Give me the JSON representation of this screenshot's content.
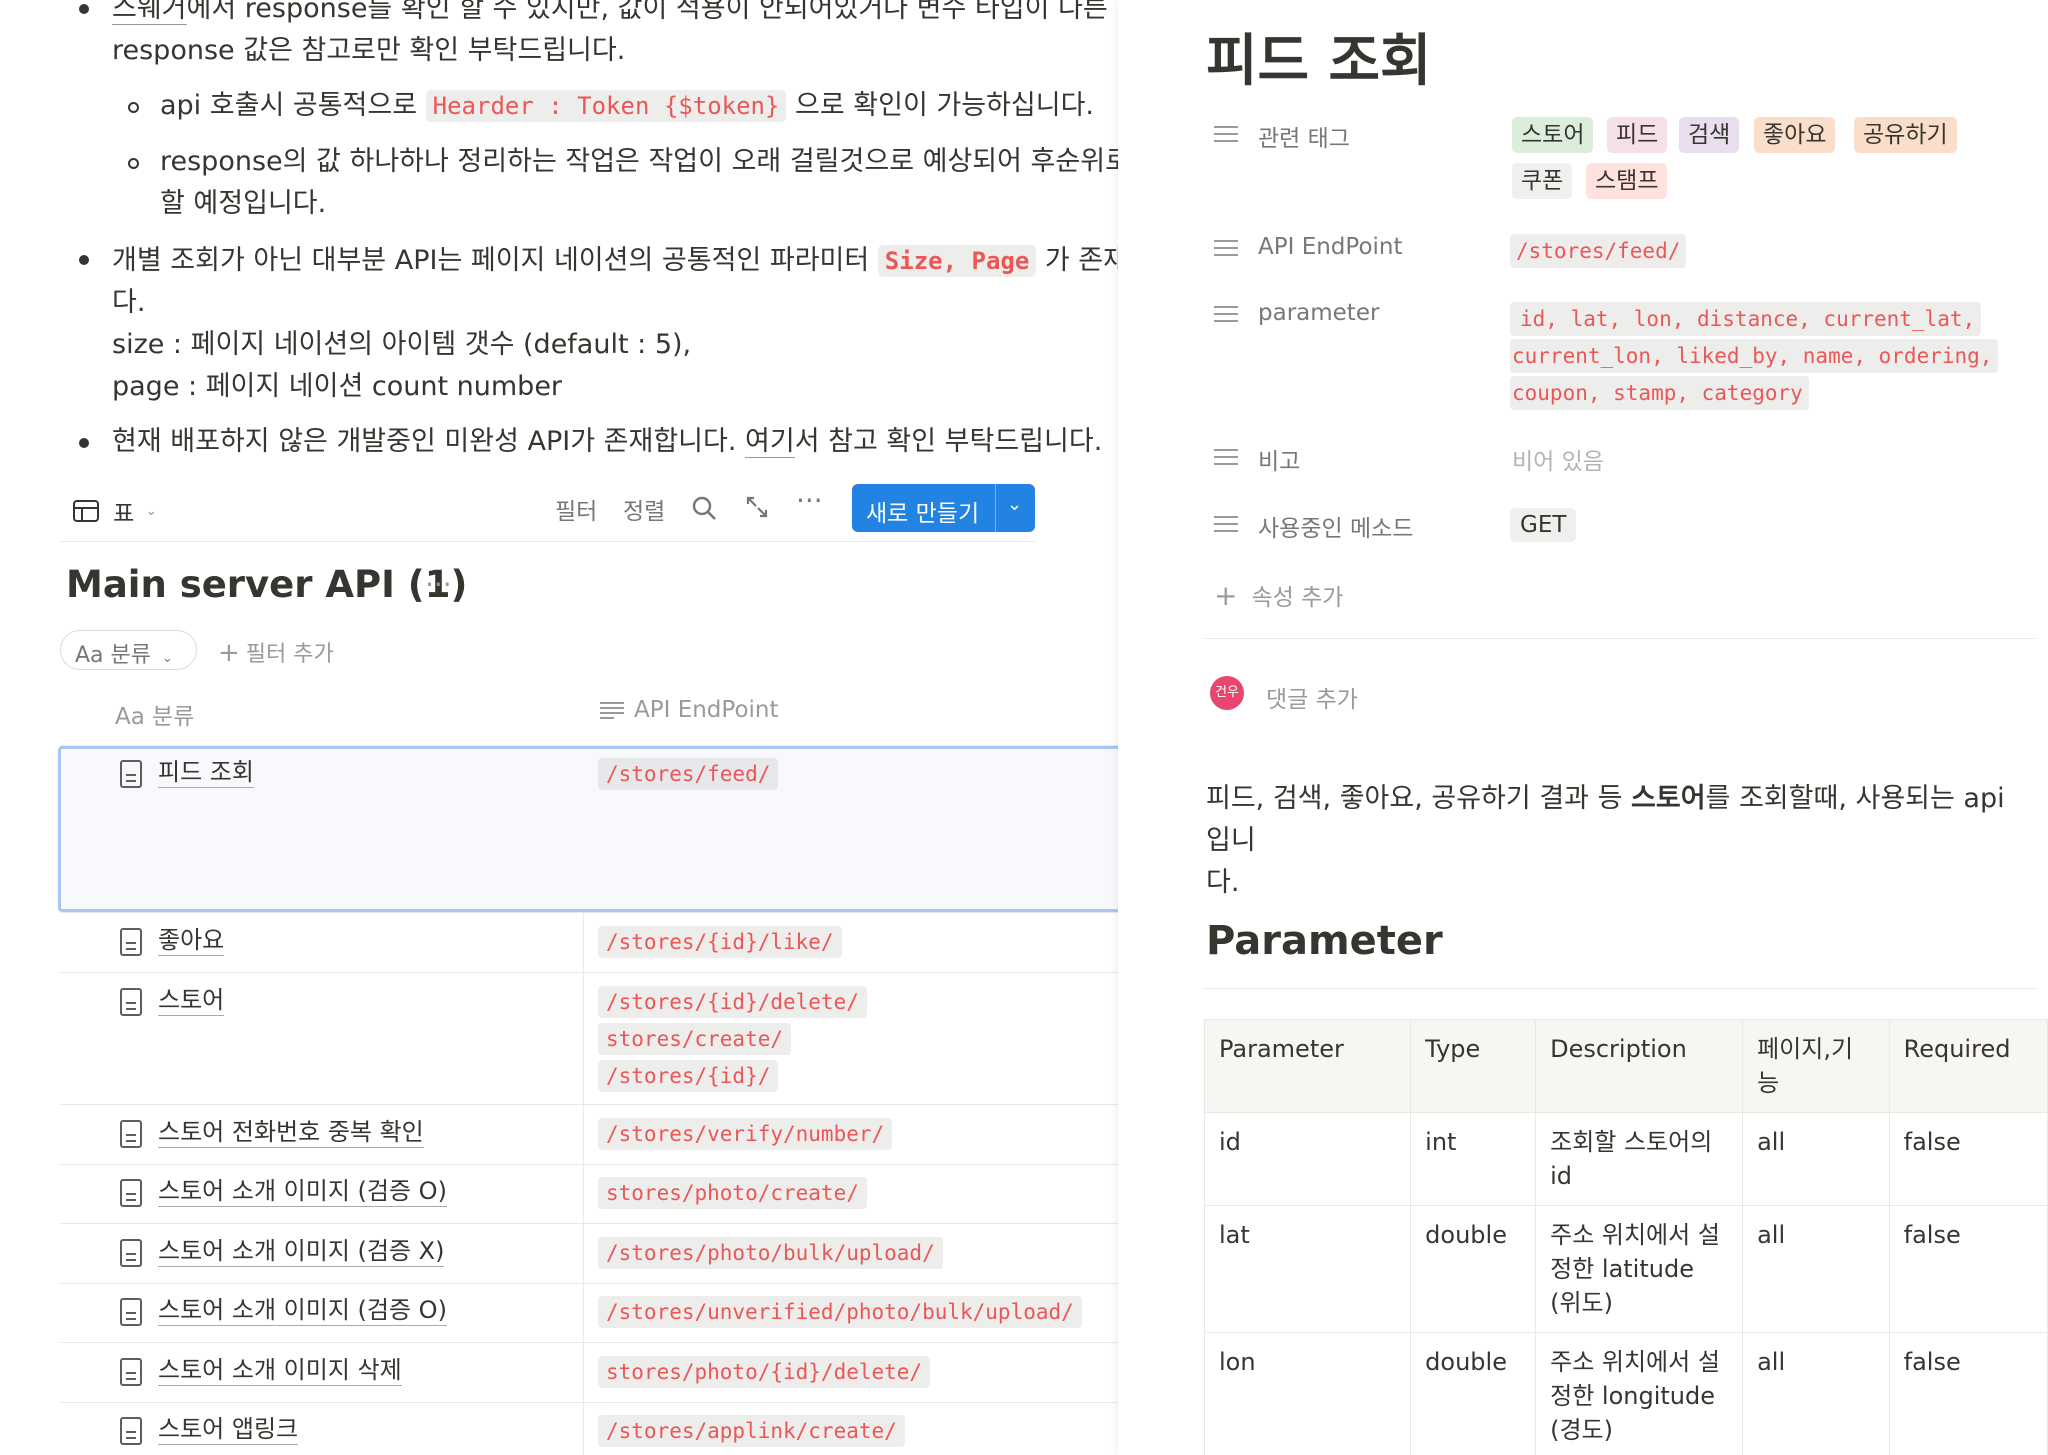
{
  "notes": {
    "b1_pre": "스웨거",
    "b1_post": "에서 response를 확인 할 수 있지만, 값이 적용이 안되어있거나 변수 타입이 다른 경우",
    "b1_line2": "response 값은 참고로만 확인 부탁드립니다.",
    "s1_pre": "api 호출시 공통적으로 ",
    "s1_code": "Hearder : Token {$token}",
    "s1_post": " 으로 확인이 가능하십니다.",
    "s2_line1": "response의 값 하나하나 정리하는 작업은 작업이 오래 걸릴것으로 예상되어 후순위로 두",
    "s2_line2": "할 예정입니다.",
    "b2_pre": "개별 조회가 아닌 대부분 API는 페이지 네이션의 공통적인 파라미터 ",
    "b2_code": "Size, Page",
    "b2_post": " 가 존재하니",
    "b2_line2": "다.",
    "b2_line3": "size : 페이지 네이션의 아이템 갯수 (default : 5),",
    "b2_line4": "page : 페이지 네이션 count number",
    "b3_pre": "현재 배포하지 않은 개발중인 미완성 API가 존재합니다. ",
    "b3_link": "여기",
    "b3_post": "서  참고 확인 부탁드립니다."
  },
  "toolbar": {
    "view_icon": "table-icon",
    "view_label": "표",
    "filter": "필터",
    "sort": "정렬",
    "new_button": "새로 만들기"
  },
  "database": {
    "title": "Main server API (1)",
    "filter_pill": "Aa 분류",
    "add_filter": "필터 추가",
    "col_name": "Aa 분류",
    "col_endpoint": "API EndPoint",
    "rows": [
      {
        "name": "피드 조회",
        "endpoints": [
          "/stores/feed/"
        ]
      },
      {
        "name": "좋아요",
        "endpoints": [
          "/stores/{id}/like/"
        ]
      },
      {
        "name": "스토어",
        "endpoints": [
          "/stores/{id}/delete/",
          "stores/create/",
          "/stores/{id}/"
        ]
      },
      {
        "name": "스토어 전화번호 중복 확인",
        "endpoints": [
          "/stores/verify/number/"
        ]
      },
      {
        "name": "스토어 소개 이미지 (검증 O)",
        "endpoints": [
          "stores/photo/create/"
        ]
      },
      {
        "name": "스토어 소개 이미지 (검증 X)",
        "endpoints": [
          "/stores/photo/bulk/upload/"
        ]
      },
      {
        "name": "스토어 소개 이미지 (검증 O)",
        "endpoints": [
          "/stores/unverified/photo/bulk/upload/"
        ]
      },
      {
        "name": "스토어 소개 이미지 삭제",
        "endpoints": [
          "stores/photo/{id}/delete/"
        ]
      },
      {
        "name": "스토어 앱링크",
        "endpoints": [
          "/stores/applink/create/"
        ]
      }
    ]
  },
  "page": {
    "title": "피드 조회",
    "props": {
      "tags_label": "관련 태그",
      "tags": [
        {
          "text": "스토어",
          "color": "#dbeddb"
        },
        {
          "text": "피드",
          "color": "#f5e0e9"
        },
        {
          "text": "검색",
          "color": "#e8deee"
        },
        {
          "text": "좋아요",
          "color": "#fadec9"
        },
        {
          "text": "공유하기",
          "color": "#fadec9"
        },
        {
          "text": "쿠폰",
          "color": "#efefed"
        },
        {
          "text": "스탬프",
          "color": "#ffe2dd"
        }
      ],
      "endpoint_label": "API EndPoint",
      "endpoint_value": "/stores/feed/",
      "param_label": "parameter",
      "param_line1": "id, lat, lon, distance, current_lat,",
      "param_line2": "current_lon, liked_by, name, ordering,",
      "param_line3": "coupon, stamp, category",
      "note_label": "비고",
      "note_value": "비어 있음",
      "method_label": "사용중인 메소드",
      "method_value": "GET",
      "add_prop": "속성 추가"
    },
    "comment": {
      "avatar": "건우",
      "placeholder": "댓글 추가"
    },
    "desc_pre": "피드, 검색, 좋아요, 공유하기 결과 등 ",
    "desc_bold": "스토어",
    "desc_post": "를 조회할때, 사용되는 api 입니",
    "desc_line2": "다.",
    "section_title": "Parameter",
    "table": {
      "headers": [
        "Parameter",
        "Type",
        "Description",
        "페이지,기능",
        "Required"
      ],
      "rows": [
        [
          "id",
          "int",
          "조회할 스토어의 id",
          "all",
          "false"
        ],
        [
          "lat",
          "double",
          "주소 위치에서 설정한 latitude (위도)",
          "all",
          "false"
        ],
        [
          "lon",
          "double",
          "주소 위치에서 설정한 longitude (경도)",
          "all",
          "false"
        ]
      ]
    }
  }
}
